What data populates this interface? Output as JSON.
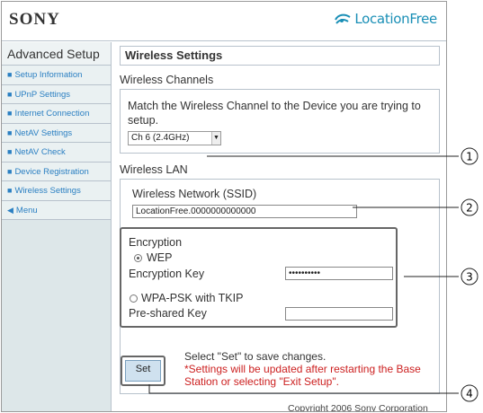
{
  "header": {
    "brand": "SONY",
    "logo_text": "LocationFree"
  },
  "sidebar": {
    "title": "Advanced Setup",
    "items": [
      {
        "label": "Setup Information"
      },
      {
        "label": "UPnP Settings"
      },
      {
        "label": "Internet Connection"
      },
      {
        "label": "NetAV Settings"
      },
      {
        "label": "NetAV Check"
      },
      {
        "label": "Device Registration"
      },
      {
        "label": "Wireless Settings"
      }
    ],
    "menu_label": "Menu"
  },
  "main": {
    "title": "Wireless Settings",
    "channels": {
      "heading": "Wireless Channels",
      "description": "Match the Wireless Channel to the Device you are trying to setup.",
      "selected": "Ch 6 (2.4GHz)"
    },
    "lan": {
      "heading": "Wireless LAN",
      "ssid_label": "Wireless Network (SSID)",
      "ssid_value": "LocationFree.0000000000000",
      "encryption": {
        "heading": "Encryption",
        "wep_label": "WEP",
        "wep_key_label": "Encryption Key",
        "wep_key_value": "••••••••••",
        "wpa_label": "WPA-PSK with TKIP",
        "psk_label": "Pre-shared Key",
        "psk_value": ""
      }
    },
    "save": {
      "button_label": "Set",
      "instruction": "Select \"Set\" to save changes.",
      "note": "*Settings will be updated after restarting the Base Station or selecting \"Exit Setup\"."
    },
    "footer": "Copyright 2006 Sony Corporation"
  },
  "callouts": [
    "1",
    "2",
    "3",
    "4"
  ],
  "colors": {
    "link": "#2a7fc2",
    "sidebar_bg": "#dde7e9",
    "note": "#cc1f1f",
    "logo": "#1a8fb6"
  }
}
